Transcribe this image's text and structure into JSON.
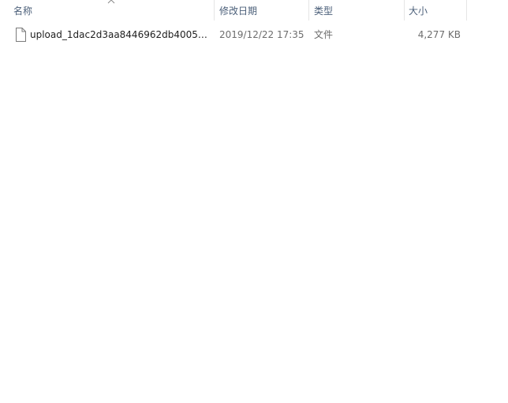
{
  "columns": {
    "name": "名称",
    "modified": "修改日期",
    "type": "类型",
    "size": "大小"
  },
  "sort": {
    "column": "name",
    "indicator": "chevron-up-icon"
  },
  "files": [
    {
      "name": "upload_1dac2d3aa8446962db4005d...",
      "modified": "2019/12/22 17:35",
      "type": "文件",
      "size": "4,277 KB",
      "icon": "generic-file-icon"
    }
  ],
  "colors": {
    "header_text": "#4c607a",
    "detail_text": "#6d6d6d",
    "separator": "#e5e5e5"
  }
}
